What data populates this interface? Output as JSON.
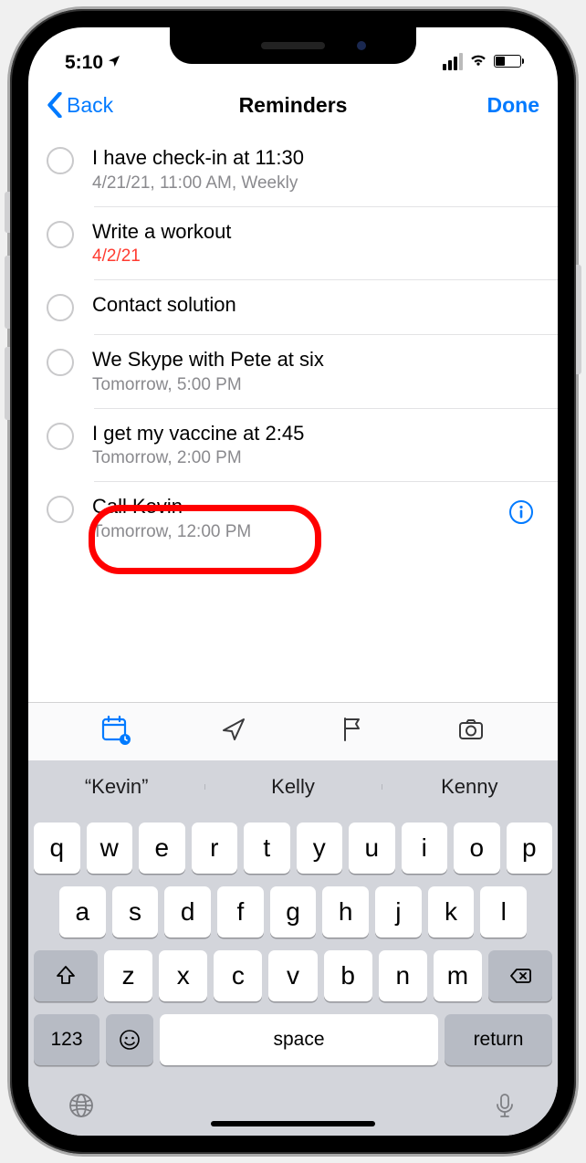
{
  "statusbar": {
    "time": "5:10"
  },
  "nav": {
    "back": "Back",
    "title": "Reminders",
    "done": "Done"
  },
  "reminders": [
    {
      "title": "I have check-in at 11:30",
      "subtitle": "4/21/21, 11:00 AM, Weekly",
      "overdue": false
    },
    {
      "title": "Write a workout",
      "subtitle": "4/2/21",
      "overdue": true
    },
    {
      "title": "Contact solution",
      "subtitle": "",
      "overdue": false
    },
    {
      "title": "We Skype with Pete at six",
      "subtitle": "Tomorrow, 5:00 PM",
      "overdue": false
    },
    {
      "title": "I get my vaccine at 2:45",
      "subtitle": "Tomorrow, 2:00 PM",
      "overdue": false
    },
    {
      "title": "Call Kevin",
      "subtitle": "Tomorrow, 12:00 PM",
      "overdue": false
    }
  ],
  "suggestions": [
    "“Kevin”",
    "Kelly",
    "Kenny"
  ],
  "keyboard": {
    "row1": [
      "q",
      "w",
      "e",
      "r",
      "t",
      "y",
      "u",
      "i",
      "o",
      "p"
    ],
    "row2": [
      "a",
      "s",
      "d",
      "f",
      "g",
      "h",
      "j",
      "k",
      "l"
    ],
    "row3": [
      "z",
      "x",
      "c",
      "v",
      "b",
      "n",
      "m"
    ],
    "numKey": "123",
    "space": "space",
    "return": "return"
  }
}
